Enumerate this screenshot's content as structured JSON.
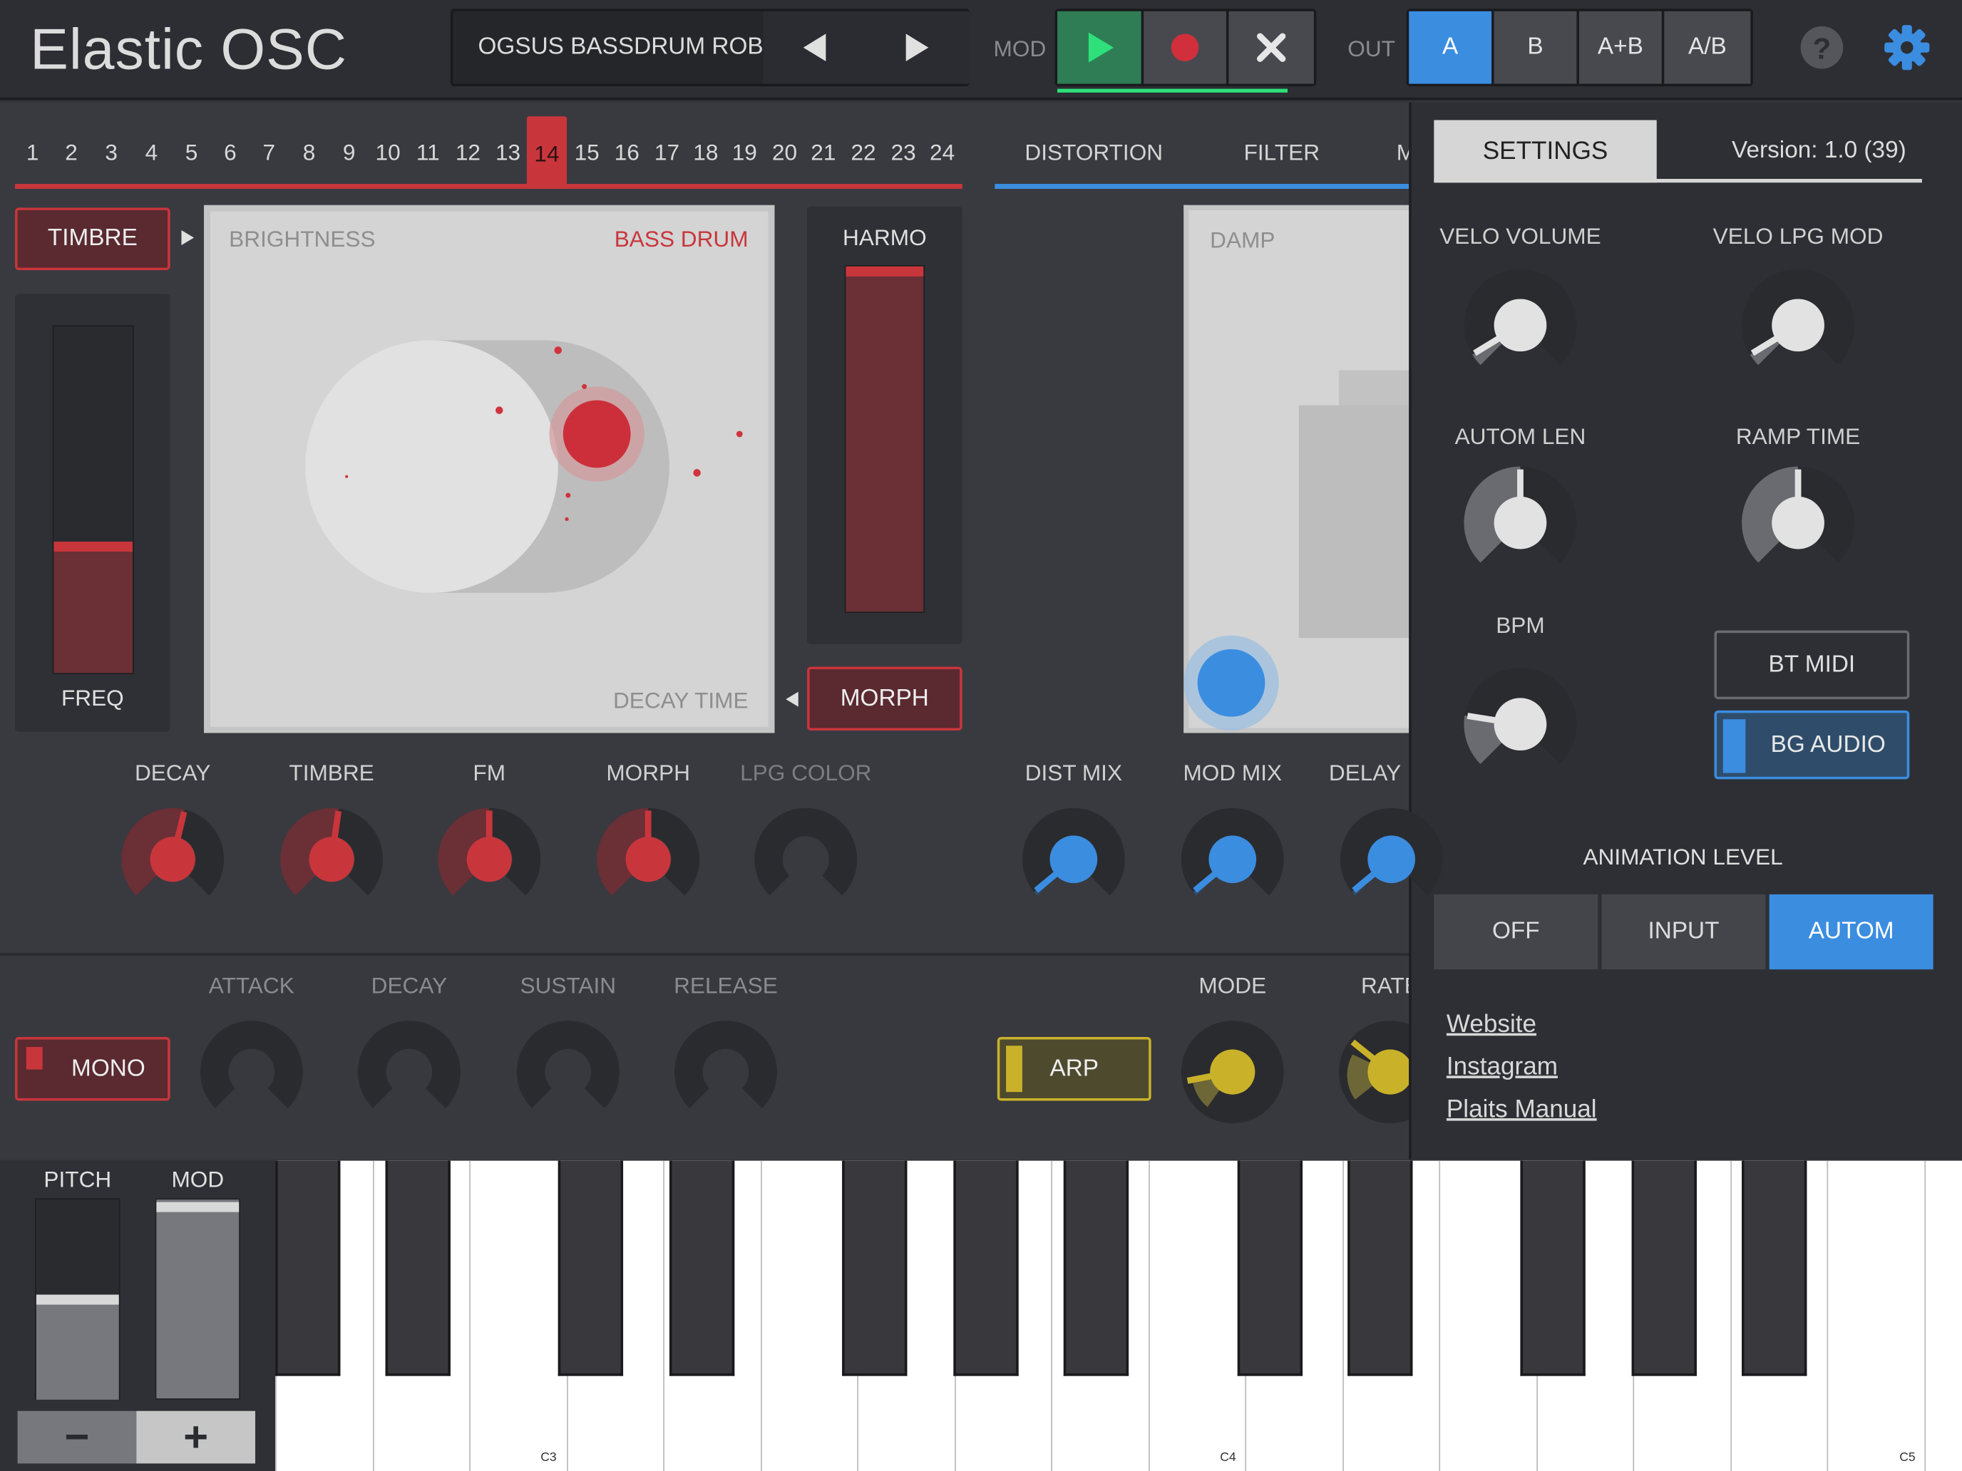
{
  "app": {
    "title": "Elastic OSC"
  },
  "preset": {
    "name": "OGSUS BASSDRUM ROBO"
  },
  "mod": {
    "label": "MOD"
  },
  "out": {
    "label": "OUT",
    "options": [
      "A",
      "B",
      "A+B",
      "A/B"
    ],
    "selected": "A"
  },
  "sequencer": {
    "steps": [
      "1",
      "2",
      "3",
      "4",
      "5",
      "6",
      "7",
      "8",
      "9",
      "10",
      "11",
      "12",
      "13",
      "14",
      "15",
      "16",
      "17",
      "18",
      "19",
      "20",
      "21",
      "22",
      "23",
      "24"
    ],
    "selected": "14"
  },
  "left": {
    "timbre_button": "TIMBRE",
    "freq_label": "FREQ",
    "xy_x_label": "BRIGHTNESS",
    "xy_model": "BASS DRUM",
    "xy_y_label": "DECAY TIME",
    "harmo_label": "HARMO",
    "morph_button": "MORPH",
    "freq_level": 0.38,
    "harmo_level": 1.0
  },
  "knobs_left": [
    {
      "label": "DECAY",
      "dim": false
    },
    {
      "label": "TIMBRE",
      "dim": false
    },
    {
      "label": "FM",
      "dim": false
    },
    {
      "label": "MORPH",
      "dim": false
    },
    {
      "label": "LPG COLOR",
      "dim": true
    }
  ],
  "fx": {
    "tabs": [
      "DISTORTION",
      "FILTER",
      "M"
    ],
    "pad_label": "DAMP",
    "knobs": [
      "DIST MIX",
      "MOD MIX",
      "DELAY"
    ]
  },
  "envelope": {
    "mono_button": "MONO",
    "labels": [
      "ATTACK",
      "DECAY",
      "SUSTAIN",
      "RELEASE"
    ]
  },
  "arp": {
    "button": "ARP",
    "mode_label": "MODE",
    "rate_label": "RATE"
  },
  "settings": {
    "tab": "SETTINGS",
    "version": "Version: 1.0 (39)",
    "knobs": [
      "VELO VOLUME",
      "VELO LPG MOD",
      "AUTOM LEN",
      "RAMP TIME",
      "BPM"
    ],
    "bt_midi": "BT MIDI",
    "bg_audio": "BG AUDIO",
    "animation_title": "ANIMATION LEVEL",
    "animation_options": [
      "OFF",
      "INPUT",
      "AUTOM"
    ],
    "animation_selected": "AUTOM",
    "links": [
      "Website",
      "Instagram",
      "Plaits Manual"
    ]
  },
  "bottom": {
    "pitch_label": "PITCH",
    "mod_label": "MOD",
    "minus": "−",
    "plus": "+"
  },
  "keyboard": {
    "octave_labels": [
      "C3",
      "C4",
      "C5"
    ]
  },
  "colors": {
    "accent_red": "#c8363c",
    "accent_blue": "#3b8de0",
    "accent_yellow": "#c9b22a",
    "play_green": "#2f7d54"
  },
  "icons": {
    "prev": "triangle-left-icon",
    "next": "triangle-right-icon",
    "play": "play-icon",
    "record": "record-icon",
    "clear": "close-icon",
    "help": "help-icon",
    "settings": "gear-icon"
  }
}
